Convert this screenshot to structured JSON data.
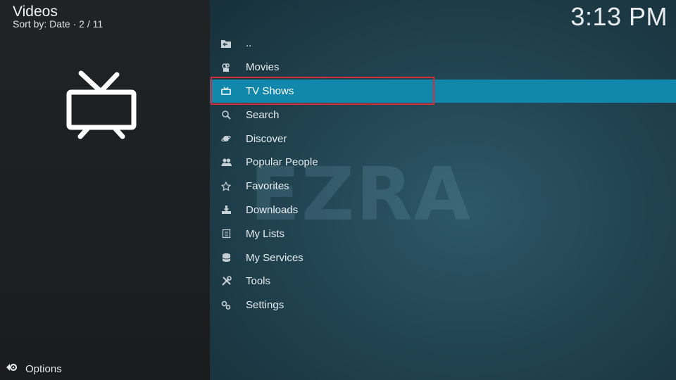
{
  "header": {
    "title": "Videos",
    "sort_text": "Sort by: Date  ·  2 / 11",
    "clock": "3:13 PM"
  },
  "menu": [
    {
      "label": "..",
      "icon": "folder-back-icon"
    },
    {
      "label": "Movies",
      "icon": "movies-icon"
    },
    {
      "label": "TV Shows",
      "icon": "tv-icon",
      "selected": true
    },
    {
      "label": "Search",
      "icon": "search-icon"
    },
    {
      "label": "Discover",
      "icon": "discover-icon"
    },
    {
      "label": "Popular People",
      "icon": "people-icon"
    },
    {
      "label": "Favorites",
      "icon": "star-icon"
    },
    {
      "label": "Downloads",
      "icon": "downloads-icon"
    },
    {
      "label": "My Lists",
      "icon": "lists-icon"
    },
    {
      "label": "My Services",
      "icon": "services-icon"
    },
    {
      "label": "Tools",
      "icon": "tools-icon"
    },
    {
      "label": "Settings",
      "icon": "settings-icon"
    }
  ],
  "watermark": "EZRA",
  "footer": {
    "options_label": "Options"
  },
  "colors": {
    "highlight": "#1187ac",
    "focus_outline": "#d42d3a"
  }
}
